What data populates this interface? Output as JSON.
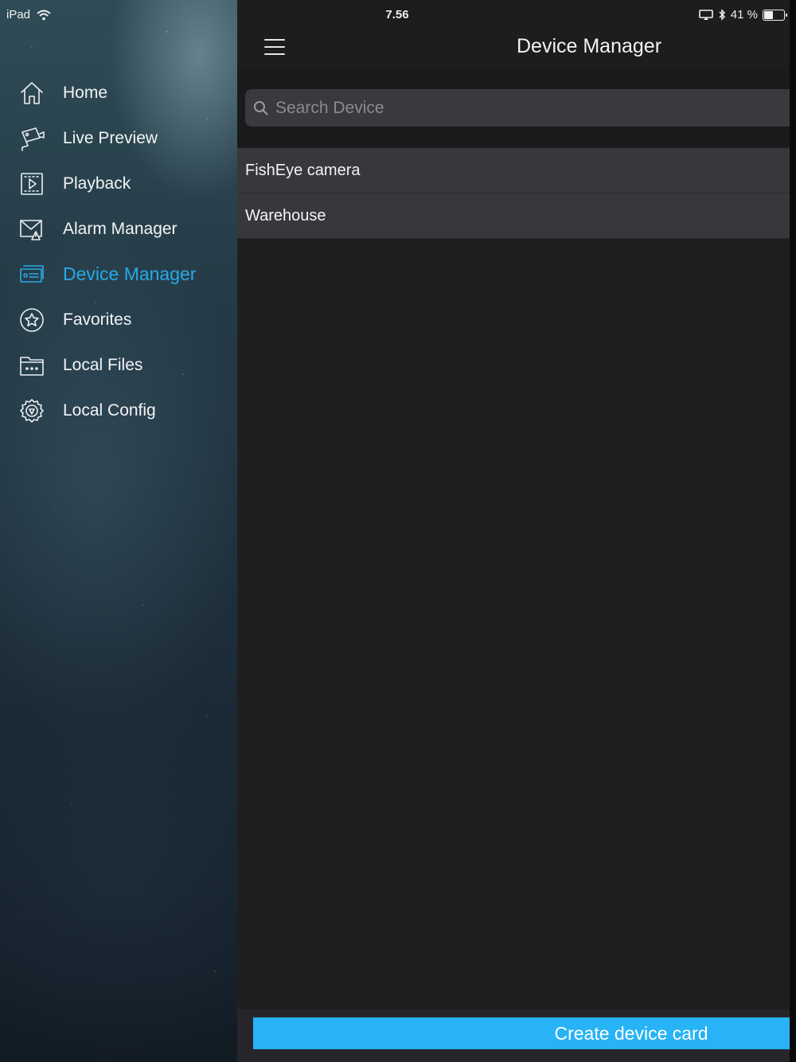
{
  "status_bar": {
    "device": "iPad",
    "time": "7.56",
    "battery_text": "41 %",
    "battery_level": 0.41,
    "icons": [
      "wifi-icon",
      "screen-mirroring-icon",
      "bluetooth-icon",
      "battery-icon"
    ]
  },
  "sidebar": {
    "items": [
      {
        "label": "Home",
        "icon": "home-icon",
        "active": false
      },
      {
        "label": "Live Preview",
        "icon": "live-preview-icon",
        "active": false
      },
      {
        "label": "Playback",
        "icon": "playback-icon",
        "active": false
      },
      {
        "label": "Alarm Manager",
        "icon": "alarm-manager-icon",
        "active": false
      },
      {
        "label": "Device Manager",
        "icon": "device-manager-icon",
        "active": true
      },
      {
        "label": "Favorites",
        "icon": "favorites-icon",
        "active": false
      },
      {
        "label": "Local Files",
        "icon": "local-files-icon",
        "active": false
      },
      {
        "label": "Local Config",
        "icon": "local-config-icon",
        "active": false
      }
    ]
  },
  "header": {
    "title": "Device Manager",
    "menu_icon": "hamburger-menu-icon"
  },
  "search": {
    "placeholder": "Search Device",
    "value": "",
    "icon": "search-icon"
  },
  "devices": [
    {
      "name": "FishEye camera"
    },
    {
      "name": "Warehouse"
    }
  ],
  "footer": {
    "create_label": "Create device card"
  },
  "colors": {
    "accent": "#27a9e6",
    "button": "#27b3f5",
    "list_row": "#38383c",
    "main_bg": "#1f1f22"
  }
}
